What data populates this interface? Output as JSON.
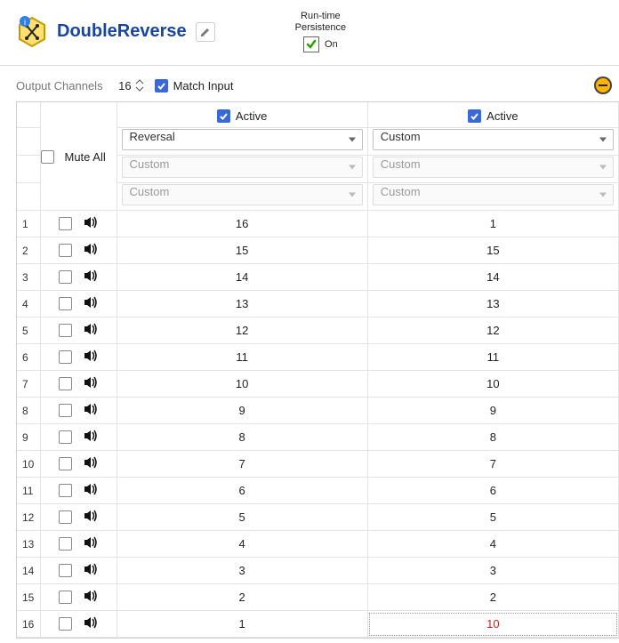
{
  "header": {
    "title": "DoubleReverse",
    "persistence_lbl1": "Run-time",
    "persistence_lbl2": "Persistence",
    "persistence_state": "On"
  },
  "config": {
    "output_channels_label": "Output Channels",
    "output_channels_value": "16",
    "match_input_label": "Match Input"
  },
  "columns": {
    "mute_all_label": "Mute All",
    "active_label": "Active",
    "col1": {
      "sel1": "Reversal",
      "sel2": "Custom",
      "sel3": "Custom"
    },
    "col2": {
      "sel1": "Custom",
      "sel2": "Custom",
      "sel3": "Custom"
    }
  },
  "rows": [
    {
      "n": "1",
      "c1": "16",
      "c2": "1",
      "hot": false
    },
    {
      "n": "2",
      "c1": "15",
      "c2": "15",
      "hot": false
    },
    {
      "n": "3",
      "c1": "14",
      "c2": "14",
      "hot": false
    },
    {
      "n": "4",
      "c1": "13",
      "c2": "13",
      "hot": false
    },
    {
      "n": "5",
      "c1": "12",
      "c2": "12",
      "hot": false
    },
    {
      "n": "6",
      "c1": "11",
      "c2": "11",
      "hot": false
    },
    {
      "n": "7",
      "c1": "10",
      "c2": "10",
      "hot": false
    },
    {
      "n": "8",
      "c1": "9",
      "c2": "9",
      "hot": false
    },
    {
      "n": "9",
      "c1": "8",
      "c2": "8",
      "hot": false
    },
    {
      "n": "10",
      "c1": "7",
      "c2": "7",
      "hot": false
    },
    {
      "n": "11",
      "c1": "6",
      "c2": "6",
      "hot": false
    },
    {
      "n": "12",
      "c1": "5",
      "c2": "5",
      "hot": false
    },
    {
      "n": "13",
      "c1": "4",
      "c2": "4",
      "hot": false
    },
    {
      "n": "14",
      "c1": "3",
      "c2": "3",
      "hot": false
    },
    {
      "n": "15",
      "c1": "2",
      "c2": "2",
      "hot": false
    },
    {
      "n": "16",
      "c1": "1",
      "c2": "10",
      "hot": true
    }
  ]
}
